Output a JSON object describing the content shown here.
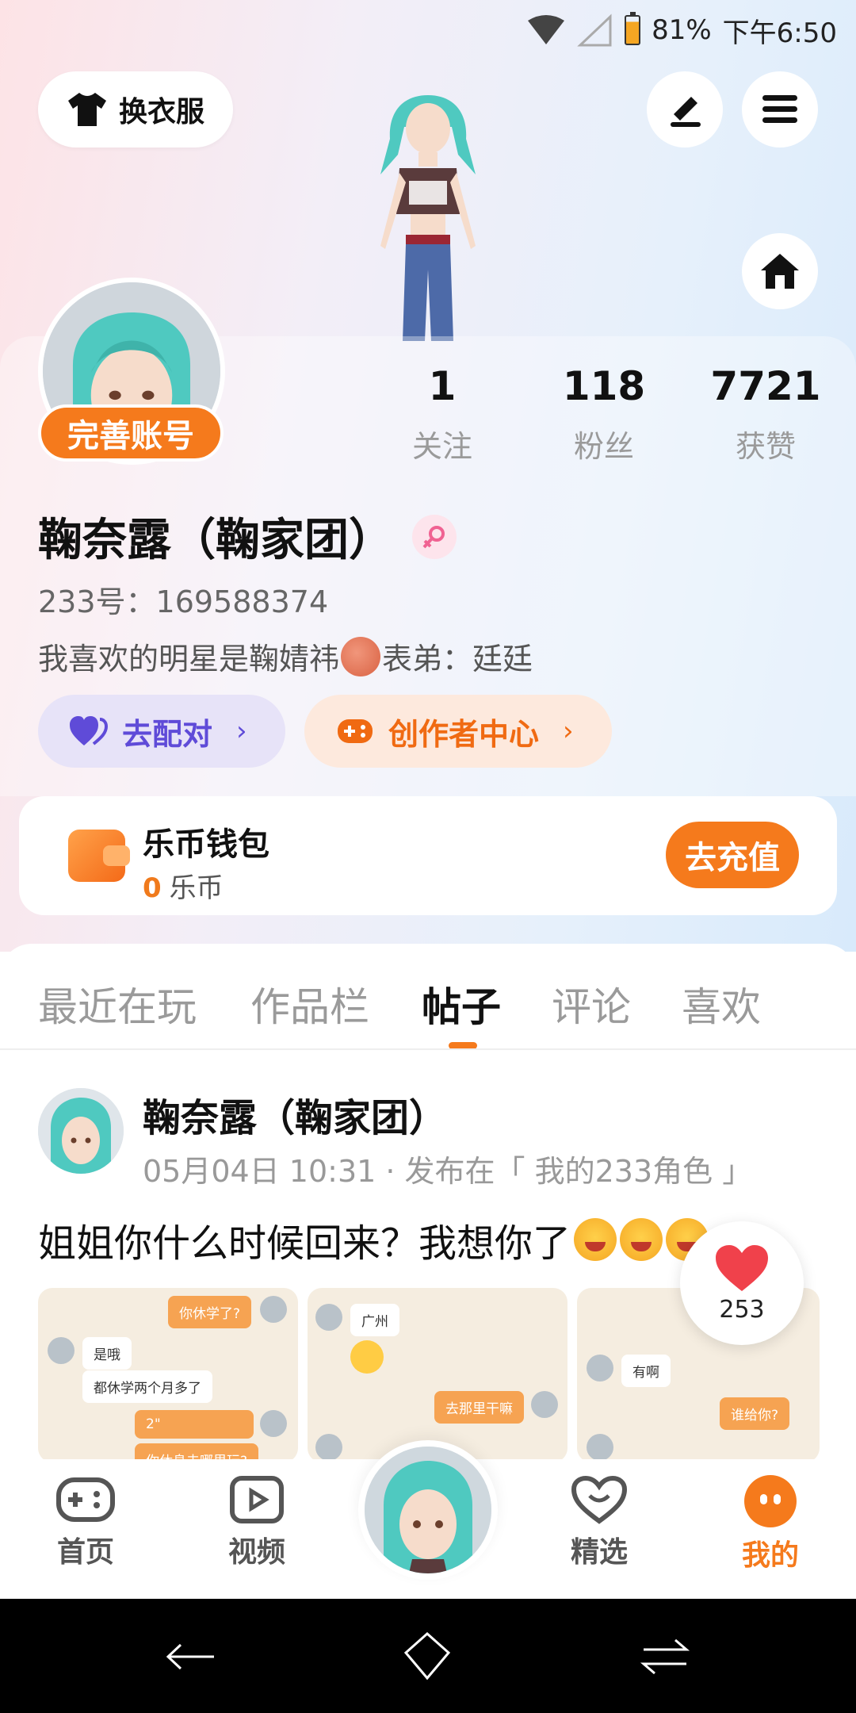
{
  "status_bar": {
    "battery": "81%",
    "time": "下午6:50"
  },
  "header": {
    "outfit_label": "换衣服"
  },
  "profile": {
    "complete_account": "完善账号",
    "stats": [
      {
        "num": "1",
        "label": "关注"
      },
      {
        "num": "118",
        "label": "粉丝"
      },
      {
        "num": "7721",
        "label": "获赞"
      }
    ],
    "username": "鞠奈露（鞠家团）",
    "uid": "233号：169588374",
    "bio_before": "我喜欢的明星是鞠婧祎",
    "bio_after": "表弟：廷廷",
    "match_label": "去配对",
    "creator_label": "创作者中心"
  },
  "wallet": {
    "title": "乐币钱包",
    "balance": "0",
    "unit": "乐币",
    "recharge_label": "去充值"
  },
  "tabs": [
    {
      "label": "最近在玩"
    },
    {
      "label": "作品栏"
    },
    {
      "label": "帖子"
    },
    {
      "label": "评论"
    },
    {
      "label": "喜欢"
    }
  ],
  "active_tab": "帖子",
  "post": {
    "author": "鞠奈露（鞠家团）",
    "meta": "05月04日 10:31 · 发布在「 我的233角色 」",
    "text": "姐姐你什么时候回来？我想你了",
    "likes": "253",
    "thumbs": [
      {
        "b1": "你休学了?",
        "b2": "是哦",
        "b3": "都休学两个月多了",
        "b4": "2\"",
        "b5": "你休息去哪里玩?"
      },
      {
        "b1": "广州",
        "b2": "去那里干嘛"
      },
      {
        "b1": "有啊",
        "b2": "谁给你?"
      }
    ]
  },
  "bottom_nav": [
    {
      "label": "首页"
    },
    {
      "label": "视频"
    },
    {
      "label": "精选"
    },
    {
      "label": "我的"
    }
  ],
  "colors": {
    "accent": "#f57a1c",
    "match": "#5f4bd8"
  }
}
